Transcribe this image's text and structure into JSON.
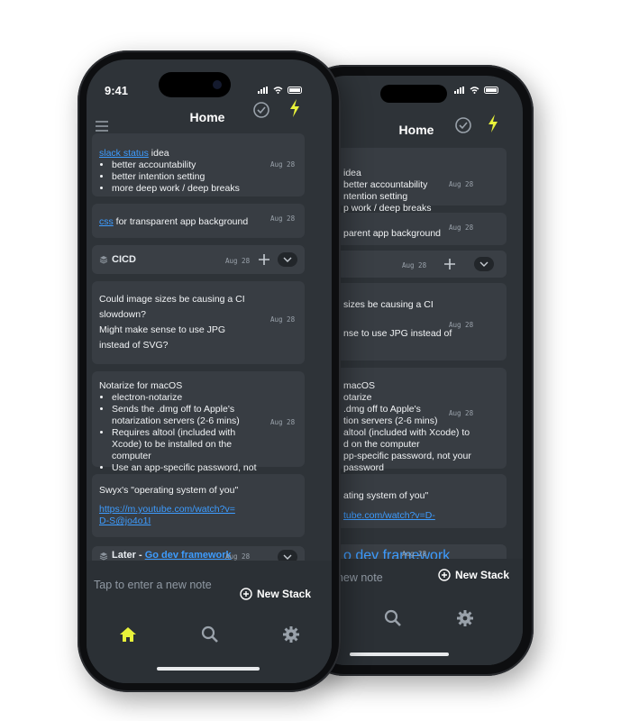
{
  "status": {
    "time": "9:41"
  },
  "header": {
    "title": "Home"
  },
  "notes": [
    {
      "link": "slack status",
      "text": " idea",
      "bullets": [
        "better accountability",
        "better intention setting",
        "more deep work / deep breaks"
      ],
      "date": "Aug 28"
    },
    {
      "link": "css",
      "text": " for transparent app background",
      "date": "Aug 28"
    },
    {
      "text": "Could image sizes be causing a CI slowdown?",
      "text2": "Might make sense to use JPG instead of SVG?",
      "date": "Aug 28"
    },
    {
      "text": "Notarize for macOS",
      "bullets": [
        "electron-notarize",
        "Sends the .dmg off to Apple's notarization servers (2-6 mins)",
        "Requires altool (included with Xcode) to be installed on the computer",
        "Use an app-specific password, not your Apple ID password"
      ],
      "date": "Aug 28"
    },
    {
      "text": "Swyx's \"operating system of you\"",
      "link": "https://m.youtube.com/watch?v=D-S@jo4o1I",
      "date": "Aug 28"
    }
  ],
  "stacks": [
    {
      "name": "CICD",
      "date": "Aug 28"
    },
    {
      "prefix": "Later - ",
      "link": "Go dev framework",
      "date": "Aug 28"
    }
  ],
  "composer": {
    "placeholder": "Tap to enter a new note",
    "new_stack": "New Stack"
  },
  "back_phone": {
    "title": "Home",
    "fragments": {
      "n1": [
        "idea",
        "better accountability",
        "ntention setting",
        "p work / deep breaks"
      ],
      "n2": "parent app background",
      "n3a": "sizes be causing a CI",
      "n3b": "nse to use JPG instead of",
      "n4": [
        "macOS",
        "otarize",
        ".dmg off to Apple's",
        "tion servers (2-6 mins)",
        "altool (included with Xcode) to",
        "d on the computer",
        "pp-specific password, not your",
        "password"
      ],
      "n5a": "ating system of you\"",
      "n5b": "tube.com/watch?v=D-",
      "stack2": "o dev framework"
    },
    "date": "Aug 28",
    "placeholder": "Tap to enter a new note",
    "new_stack": "New Stack"
  },
  "colors": {
    "accent_bolt": "#e8f23a",
    "home_tab": "#e8f23a",
    "link": "#3d9cff",
    "screen_bg": "#2e3338",
    "card_bg": "#383d43"
  },
  "icons": [
    "hamburger-icon",
    "check-circle-icon",
    "bolt-icon",
    "plus-icon",
    "chevron-down-icon",
    "plus-circle-icon",
    "home-icon",
    "search-icon",
    "gear-icon",
    "stack-icon"
  ]
}
